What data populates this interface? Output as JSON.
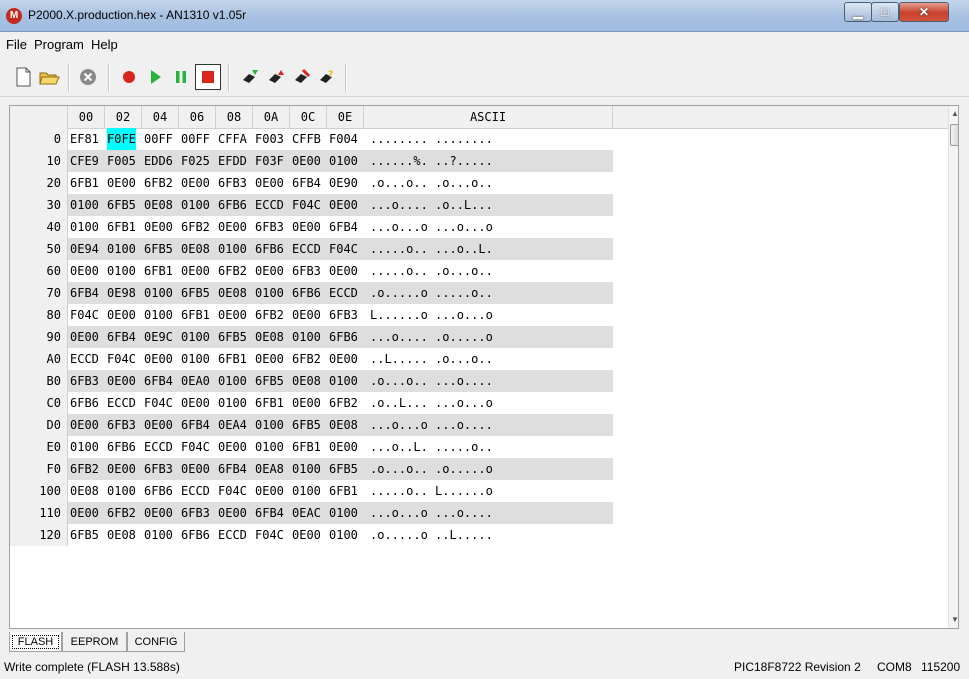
{
  "window": {
    "title": "P2000.X.production.hex - AN1310 v1.05r",
    "app_icon": "microchip-logo"
  },
  "menu": [
    "File",
    "Program",
    "Help"
  ],
  "toolbar": [
    "new-file-icon",
    "open-folder-icon",
    "abort-icon",
    "record-icon",
    "run-icon",
    "pause-icon",
    "stop-icon",
    "read-chip-icon",
    "write-chip-icon",
    "erase-chip-icon",
    "verify-chip-icon"
  ],
  "grid": {
    "headers": [
      "00",
      "02",
      "04",
      "06",
      "08",
      "0A",
      "0C",
      "0E",
      "ASCII"
    ],
    "selected": {
      "row": 0,
      "col": 1
    },
    "rows": [
      {
        "addr": "0",
        "cells": [
          "EF81",
          "F0FE",
          "00FF",
          "00FF",
          "CFFA",
          "F003",
          "CFFB",
          "F004"
        ],
        "ascii": "........ ........"
      },
      {
        "addr": "10",
        "cells": [
          "CFE9",
          "F005",
          "EDD6",
          "F025",
          "EFDD",
          "F03F",
          "0E00",
          "0100"
        ],
        "ascii": "......%. ..?....."
      },
      {
        "addr": "20",
        "cells": [
          "6FB1",
          "0E00",
          "6FB2",
          "0E00",
          "6FB3",
          "0E00",
          "6FB4",
          "0E90"
        ],
        "ascii": ".o...o.. .o...o.."
      },
      {
        "addr": "30",
        "cells": [
          "0100",
          "6FB5",
          "0E08",
          "0100",
          "6FB6",
          "ECCD",
          "F04C",
          "0E00"
        ],
        "ascii": "...o.... .o..L..."
      },
      {
        "addr": "40",
        "cells": [
          "0100",
          "6FB1",
          "0E00",
          "6FB2",
          "0E00",
          "6FB3",
          "0E00",
          "6FB4"
        ],
        "ascii": "...o...o ...o...o"
      },
      {
        "addr": "50",
        "cells": [
          "0E94",
          "0100",
          "6FB5",
          "0E08",
          "0100",
          "6FB6",
          "ECCD",
          "F04C"
        ],
        "ascii": ".....o.. ...o..L."
      },
      {
        "addr": "60",
        "cells": [
          "0E00",
          "0100",
          "6FB1",
          "0E00",
          "6FB2",
          "0E00",
          "6FB3",
          "0E00"
        ],
        "ascii": ".....o.. .o...o.."
      },
      {
        "addr": "70",
        "cells": [
          "6FB4",
          "0E98",
          "0100",
          "6FB5",
          "0E08",
          "0100",
          "6FB6",
          "ECCD"
        ],
        "ascii": ".o.....o .....o.."
      },
      {
        "addr": "80",
        "cells": [
          "F04C",
          "0E00",
          "0100",
          "6FB1",
          "0E00",
          "6FB2",
          "0E00",
          "6FB3"
        ],
        "ascii": "L......o ...o...o"
      },
      {
        "addr": "90",
        "cells": [
          "0E00",
          "6FB4",
          "0E9C",
          "0100",
          "6FB5",
          "0E08",
          "0100",
          "6FB6"
        ],
        "ascii": "...o.... .o.....o"
      },
      {
        "addr": "A0",
        "cells": [
          "ECCD",
          "F04C",
          "0E00",
          "0100",
          "6FB1",
          "0E00",
          "6FB2",
          "0E00"
        ],
        "ascii": "..L..... .o...o.."
      },
      {
        "addr": "B0",
        "cells": [
          "6FB3",
          "0E00",
          "6FB4",
          "0EA0",
          "0100",
          "6FB5",
          "0E08",
          "0100"
        ],
        "ascii": ".o...o.. ...o...."
      },
      {
        "addr": "C0",
        "cells": [
          "6FB6",
          "ECCD",
          "F04C",
          "0E00",
          "0100",
          "6FB1",
          "0E00",
          "6FB2"
        ],
        "ascii": ".o..L... ...o...o"
      },
      {
        "addr": "D0",
        "cells": [
          "0E00",
          "6FB3",
          "0E00",
          "6FB4",
          "0EA4",
          "0100",
          "6FB5",
          "0E08"
        ],
        "ascii": "...o...o ...o...."
      },
      {
        "addr": "E0",
        "cells": [
          "0100",
          "6FB6",
          "ECCD",
          "F04C",
          "0E00",
          "0100",
          "6FB1",
          "0E00"
        ],
        "ascii": "...o..L. .....o.."
      },
      {
        "addr": "F0",
        "cells": [
          "6FB2",
          "0E00",
          "6FB3",
          "0E00",
          "6FB4",
          "0EA8",
          "0100",
          "6FB5"
        ],
        "ascii": ".o...o.. .o.....o"
      },
      {
        "addr": "100",
        "cells": [
          "0E08",
          "0100",
          "6FB6",
          "ECCD",
          "F04C",
          "0E00",
          "0100",
          "6FB1"
        ],
        "ascii": ".....o.. L......o"
      },
      {
        "addr": "110",
        "cells": [
          "0E00",
          "6FB2",
          "0E00",
          "6FB3",
          "0E00",
          "6FB4",
          "0EAC",
          "0100"
        ],
        "ascii": "...o...o ...o...."
      },
      {
        "addr": "120",
        "cells": [
          "6FB5",
          "0E08",
          "0100",
          "6FB6",
          "ECCD",
          "F04C",
          "0E00",
          "0100"
        ],
        "ascii": ".o.....o ..L....."
      }
    ]
  },
  "tabs": [
    "FLASH",
    "EEPROM",
    "CONFIG"
  ],
  "status": {
    "left": "Write complete (FLASH 13.588s)",
    "device": "PIC18F8722 Revision 2",
    "port": "COM8",
    "baud": "115200"
  }
}
